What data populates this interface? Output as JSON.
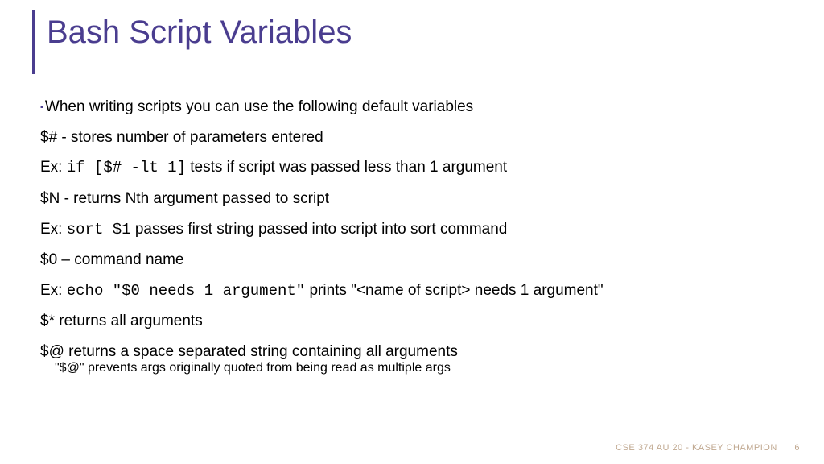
{
  "title": "Bash Script Variables",
  "lines": {
    "l0": "When writing scripts you can use the following default variables",
    "l1": "$# - stores number of parameters entered",
    "l2a": "Ex: ",
    "l2b": "if [$# -lt 1]",
    "l2c": " tests if script was passed less than 1 argument",
    "l3": "$N - returns Nth argument passed to script",
    "l4a": "Ex: ",
    "l4b": "sort $1",
    "l4c": " passes first string passed into script into sort command",
    "l5": "$0 – command name",
    "l6a": "Ex: ",
    "l6b": "echo \"$0 needs 1 argument\"",
    "l6c": " prints \"<name of script> needs 1 argument\"",
    "l7": "$* returns all arguments",
    "l8": "$@ returns a space separated string containing all arguments",
    "l9": "\"$@\" prevents args originally quoted from being read as multiple args"
  },
  "footer": {
    "text": "CSE 374 AU 20 - KASEY CHAMPION",
    "page": "6"
  }
}
